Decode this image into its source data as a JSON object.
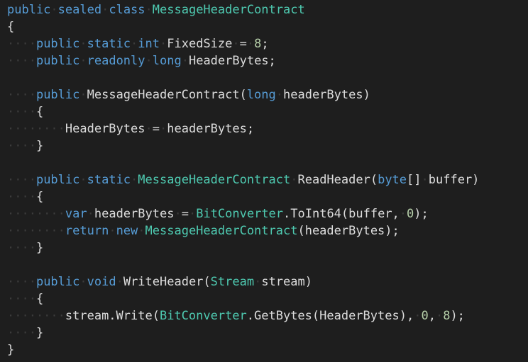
{
  "editor": {
    "lines": [
      {
        "indent": 0,
        "tokens": [
          {
            "t": "kw",
            "v": "public"
          },
          {
            "t": "ws",
            "v": " "
          },
          {
            "t": "kw",
            "v": "sealed"
          },
          {
            "t": "ws",
            "v": " "
          },
          {
            "t": "kw",
            "v": "class"
          },
          {
            "t": "ws",
            "v": " "
          },
          {
            "t": "ty",
            "v": "MessageHeaderContract"
          }
        ]
      },
      {
        "indent": 0,
        "tokens": [
          {
            "t": "pl",
            "v": "{"
          }
        ]
      },
      {
        "indent": 4,
        "tokens": [
          {
            "t": "kw",
            "v": "public"
          },
          {
            "t": "ws",
            "v": " "
          },
          {
            "t": "kw",
            "v": "static"
          },
          {
            "t": "ws",
            "v": " "
          },
          {
            "t": "kw",
            "v": "int"
          },
          {
            "t": "ws",
            "v": " "
          },
          {
            "t": "pl",
            "v": "FixedSize"
          },
          {
            "t": "ws",
            "v": " "
          },
          {
            "t": "pl",
            "v": "="
          },
          {
            "t": "ws",
            "v": " "
          },
          {
            "t": "nu",
            "v": "8"
          },
          {
            "t": "pl",
            "v": ";"
          }
        ]
      },
      {
        "indent": 4,
        "tokens": [
          {
            "t": "kw",
            "v": "public"
          },
          {
            "t": "ws",
            "v": " "
          },
          {
            "t": "kw",
            "v": "readonly"
          },
          {
            "t": "ws",
            "v": " "
          },
          {
            "t": "kw",
            "v": "long"
          },
          {
            "t": "ws",
            "v": " "
          },
          {
            "t": "pl",
            "v": "HeaderBytes;"
          }
        ]
      },
      {
        "indent": 0,
        "tokens": []
      },
      {
        "indent": 4,
        "tokens": [
          {
            "t": "kw",
            "v": "public"
          },
          {
            "t": "ws",
            "v": " "
          },
          {
            "t": "pl",
            "v": "MessageHeaderContract("
          },
          {
            "t": "kw",
            "v": "long"
          },
          {
            "t": "ws",
            "v": " "
          },
          {
            "t": "pl",
            "v": "headerBytes)"
          }
        ]
      },
      {
        "indent": 4,
        "tokens": [
          {
            "t": "pl",
            "v": "{"
          }
        ]
      },
      {
        "indent": 8,
        "tokens": [
          {
            "t": "pl",
            "v": "HeaderBytes"
          },
          {
            "t": "ws",
            "v": " "
          },
          {
            "t": "pl",
            "v": "="
          },
          {
            "t": "ws",
            "v": " "
          },
          {
            "t": "pl",
            "v": "headerBytes;"
          }
        ]
      },
      {
        "indent": 4,
        "tokens": [
          {
            "t": "pl",
            "v": "}"
          }
        ]
      },
      {
        "indent": 0,
        "tokens": []
      },
      {
        "indent": 4,
        "tokens": [
          {
            "t": "kw",
            "v": "public"
          },
          {
            "t": "ws",
            "v": " "
          },
          {
            "t": "kw",
            "v": "static"
          },
          {
            "t": "ws",
            "v": " "
          },
          {
            "t": "ty",
            "v": "MessageHeaderContract"
          },
          {
            "t": "ws",
            "v": " "
          },
          {
            "t": "pl",
            "v": "ReadHeader("
          },
          {
            "t": "kw",
            "v": "byte"
          },
          {
            "t": "pl",
            "v": "[]"
          },
          {
            "t": "ws",
            "v": " "
          },
          {
            "t": "pl",
            "v": "buffer)"
          }
        ]
      },
      {
        "indent": 4,
        "tokens": [
          {
            "t": "pl",
            "v": "{"
          }
        ]
      },
      {
        "indent": 8,
        "tokens": [
          {
            "t": "kw",
            "v": "var"
          },
          {
            "t": "ws",
            "v": " "
          },
          {
            "t": "pl",
            "v": "headerBytes"
          },
          {
            "t": "ws",
            "v": " "
          },
          {
            "t": "pl",
            "v": "="
          },
          {
            "t": "ws",
            "v": " "
          },
          {
            "t": "ty",
            "v": "BitConverter"
          },
          {
            "t": "pl",
            "v": ".ToInt64(buffer,"
          },
          {
            "t": "ws",
            "v": " "
          },
          {
            "t": "nu",
            "v": "0"
          },
          {
            "t": "pl",
            "v": ");"
          }
        ]
      },
      {
        "indent": 8,
        "tokens": [
          {
            "t": "kw",
            "v": "return"
          },
          {
            "t": "ws",
            "v": " "
          },
          {
            "t": "kw",
            "v": "new"
          },
          {
            "t": "ws",
            "v": " "
          },
          {
            "t": "ty",
            "v": "MessageHeaderContract"
          },
          {
            "t": "pl",
            "v": "(headerBytes);"
          }
        ]
      },
      {
        "indent": 4,
        "tokens": [
          {
            "t": "pl",
            "v": "}"
          }
        ]
      },
      {
        "indent": 0,
        "tokens": []
      },
      {
        "indent": 4,
        "tokens": [
          {
            "t": "kw",
            "v": "public"
          },
          {
            "t": "ws",
            "v": " "
          },
          {
            "t": "kw",
            "v": "void"
          },
          {
            "t": "ws",
            "v": " "
          },
          {
            "t": "pl",
            "v": "WriteHeader("
          },
          {
            "t": "ty",
            "v": "Stream"
          },
          {
            "t": "ws",
            "v": " "
          },
          {
            "t": "pl",
            "v": "stream)"
          }
        ]
      },
      {
        "indent": 4,
        "tokens": [
          {
            "t": "pl",
            "v": "{"
          }
        ]
      },
      {
        "indent": 8,
        "tokens": [
          {
            "t": "pl",
            "v": "stream.Write("
          },
          {
            "t": "ty",
            "v": "BitConverter"
          },
          {
            "t": "pl",
            "v": ".GetBytes(HeaderBytes),"
          },
          {
            "t": "ws",
            "v": " "
          },
          {
            "t": "nu",
            "v": "0"
          },
          {
            "t": "pl",
            "v": ","
          },
          {
            "t": "ws",
            "v": " "
          },
          {
            "t": "nu",
            "v": "8"
          },
          {
            "t": "pl",
            "v": ");"
          }
        ]
      },
      {
        "indent": 4,
        "tokens": [
          {
            "t": "pl",
            "v": "}"
          }
        ]
      },
      {
        "indent": 0,
        "tokens": [
          {
            "t": "pl",
            "v": "}"
          }
        ]
      }
    ]
  },
  "colors": {
    "background": "#1e1e1e",
    "keyword": "#569cd6",
    "type": "#4ec9b0",
    "number": "#b5cea8",
    "plain": "#dcdcdc",
    "whitespace_dot": "#3c3c3c"
  }
}
